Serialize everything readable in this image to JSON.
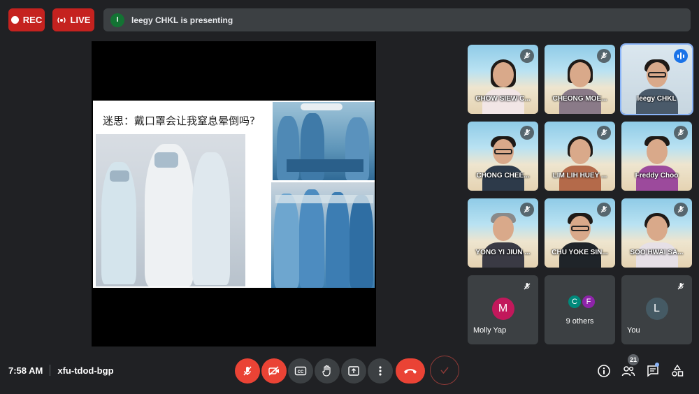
{
  "top_bar": {
    "rec_label": "REC",
    "live_label": "LIVE",
    "presenter_initial": "I",
    "presenting_text": "leegy CHKL is presenting"
  },
  "slide": {
    "title": "迷思：戴口罩会让我窒息晕倒吗?"
  },
  "participants": [
    {
      "name": "CHOW SIEW C...",
      "muted": true
    },
    {
      "name": "CHEONG MOE...",
      "muted": true
    },
    {
      "name": "leegy CHKL",
      "muted": false,
      "speaking": true
    },
    {
      "name": "CHONG CHEE...",
      "muted": true
    },
    {
      "name": "LIM LIH HUEY ...",
      "muted": true
    },
    {
      "name": "Freddy Choo",
      "muted": true
    },
    {
      "name": "YONG YI JIUN ...",
      "muted": true
    },
    {
      "name": "CHU YOKE SIN...",
      "muted": true
    },
    {
      "name": "SOO HWAI SA...",
      "muted": true
    }
  ],
  "audio_tiles": {
    "molly": {
      "initial": "M",
      "name": "Molly Yap",
      "color": "#c2185b"
    },
    "others": {
      "initial_a": "C",
      "initial_b": "F",
      "label": "9 others",
      "color_a": "#00897b",
      "color_b": "#8e24aa"
    },
    "you": {
      "initial": "L",
      "name": "You",
      "color": "#455a64"
    }
  },
  "meeting": {
    "time": "7:58 AM",
    "code": "xfu-tdod-bgp"
  },
  "people_count": "21",
  "colors": {
    "accent_red": "#ea4335",
    "rec_red": "#c5221f",
    "speaking_blue": "#1a73e8",
    "background": "#202124",
    "tile_grey": "#3c4043"
  },
  "icons": {
    "mic_off": "mic-off-icon",
    "cam_off": "videocam-off-icon",
    "captions": "closed-caption-icon",
    "raise_hand": "hand-icon",
    "present": "present-screen-icon",
    "more": "more-vert-icon",
    "hangup": "call-end-icon",
    "info": "info-icon",
    "people": "people-icon",
    "chat": "chat-icon",
    "activities": "shapes-icon"
  }
}
